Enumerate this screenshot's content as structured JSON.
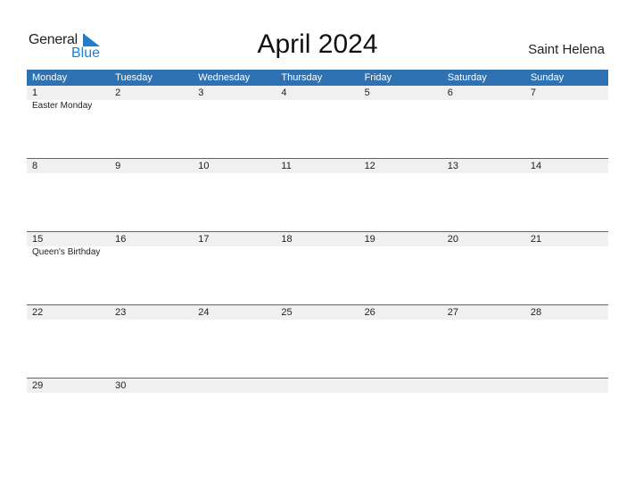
{
  "logo": {
    "word1": "General",
    "word2": "Blue"
  },
  "title": "April 2024",
  "country": "Saint Helena",
  "colors": {
    "header_bg": "#2e72b4",
    "logo_blue": "#1e7fd0",
    "day_row_bg": "#f0f0f0"
  },
  "weekdays": [
    "Monday",
    "Tuesday",
    "Wednesday",
    "Thursday",
    "Friday",
    "Saturday",
    "Sunday"
  ],
  "weeks": [
    {
      "days": [
        "1",
        "2",
        "3",
        "4",
        "5",
        "6",
        "7"
      ],
      "events": [
        "Easter Monday",
        "",
        "",
        "",
        "",
        "",
        ""
      ]
    },
    {
      "days": [
        "8",
        "9",
        "10",
        "11",
        "12",
        "13",
        "14"
      ],
      "events": [
        "",
        "",
        "",
        "",
        "",
        "",
        ""
      ]
    },
    {
      "days": [
        "15",
        "16",
        "17",
        "18",
        "19",
        "20",
        "21"
      ],
      "events": [
        "Queen's Birthday",
        "",
        "",
        "",
        "",
        "",
        ""
      ]
    },
    {
      "days": [
        "22",
        "23",
        "24",
        "25",
        "26",
        "27",
        "28"
      ],
      "events": [
        "",
        "",
        "",
        "",
        "",
        "",
        ""
      ]
    },
    {
      "days": [
        "29",
        "30",
        "",
        "",
        "",
        "",
        ""
      ],
      "events": [
        "",
        "",
        "",
        "",
        "",
        "",
        ""
      ]
    }
  ]
}
